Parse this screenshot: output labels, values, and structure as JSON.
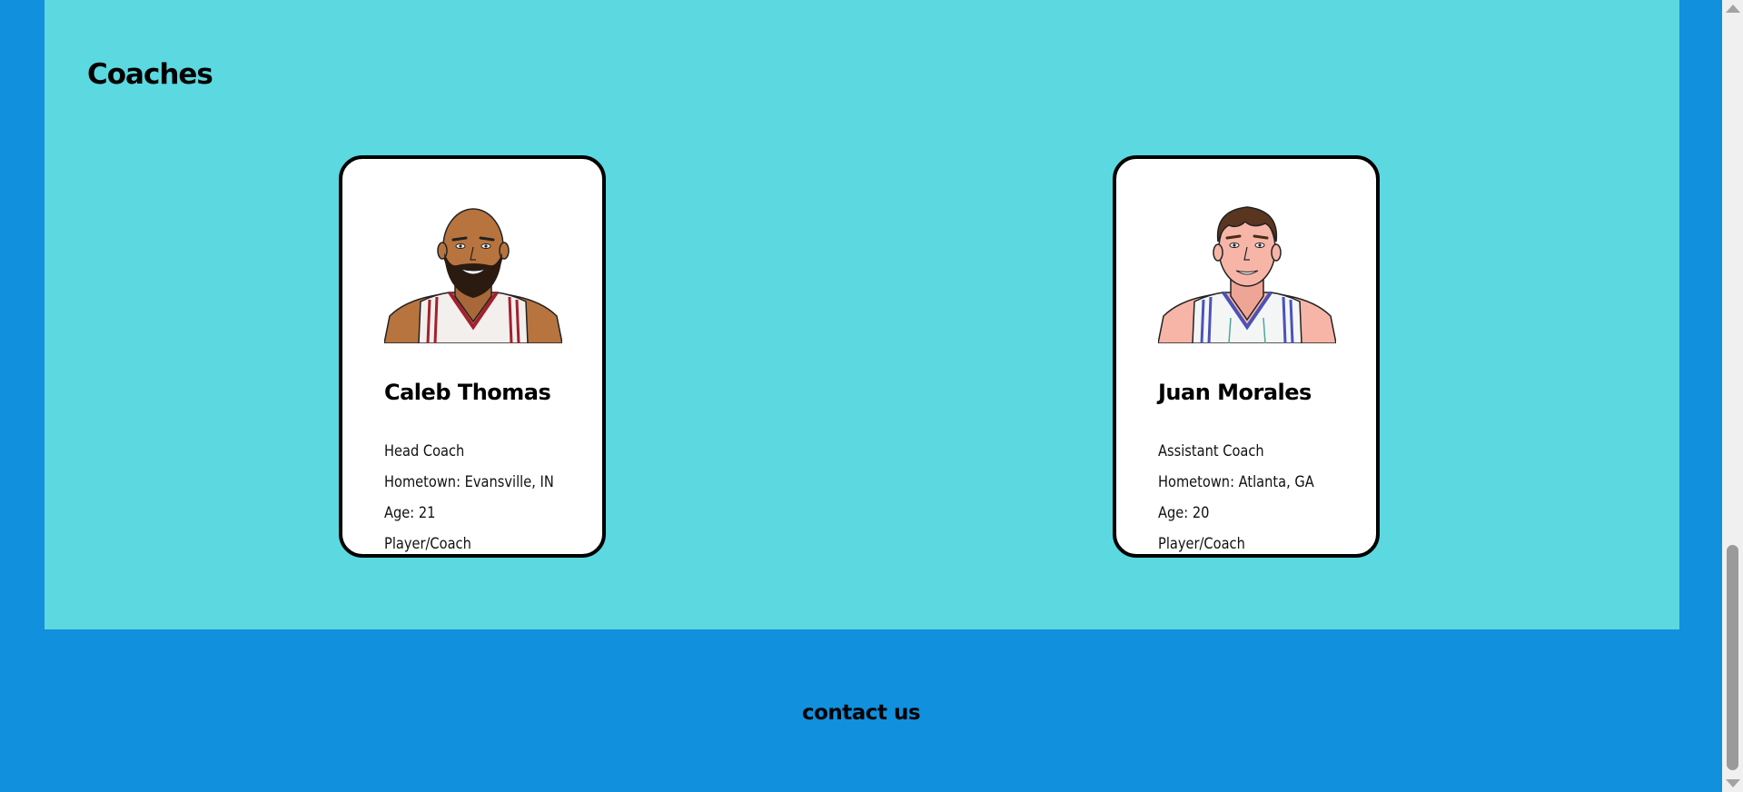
{
  "section": {
    "title": "Coaches"
  },
  "coaches": [
    {
      "name": "Caleb Thomas",
      "role": "Head Coach",
      "hometown": "Hometown: Evansville, IN",
      "age": "Age: 21",
      "type": "Player/Coach",
      "portrait_icon": "bald-bearded-man-portrait",
      "skin": "#b8743f",
      "jersey_trim": "#a3202e"
    },
    {
      "name": "Juan Morales",
      "role": "Assistant Coach",
      "hometown": "Hometown: Atlanta, GA",
      "age": "Age: 20",
      "type": "Player/Coach",
      "portrait_icon": "brown-haired-man-portrait",
      "skin": "#f7b5a8",
      "jersey_trim": "#4a52b8"
    }
  ],
  "footer": {
    "contact_label": "contact us"
  },
  "colors": {
    "page_background": "#1190de",
    "panel_background": "#5cd8e0",
    "card_background": "#ffffff",
    "card_border": "#000000"
  }
}
